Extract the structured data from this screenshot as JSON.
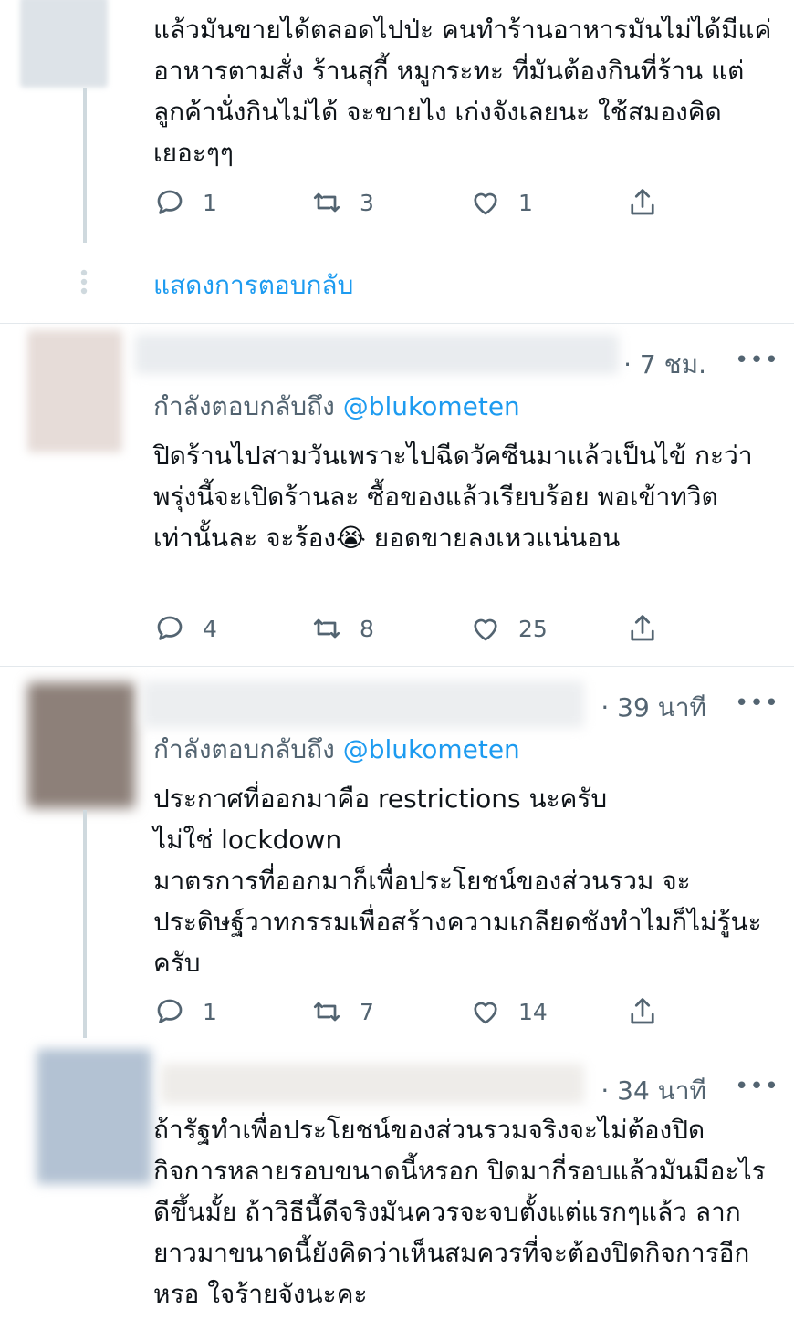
{
  "tweets": [
    {
      "text": "แล้วมันขายได้ตลอดไปป่ะ คนทำร้านอาหารมันไม่ได้มีแค่อาหารตามสั่ง ร้านสุกี้ หมูกระทะ ที่มันต้องกินที่ร้าน แต่ลูกค้านั่งกินไม่ได้ จะขายไง เก่งจังเลยนะ ใช้สมองคิดเยอะๆๆ",
      "replies": "1",
      "retweets": "3",
      "likes": "1"
    },
    {
      "time": "· 7 ชม.",
      "replying_prefix": "กำลังตอบกลับถึง",
      "replying_handle": "@blukometen",
      "text": "ปิดร้านไปสามวันเพราะไปฉีดวัคซีนมาแล้วเป็นไข้ กะว่าพรุ่งนี้จะเปิดร้านละ ซื้อของแล้วเรียบร้อย พอเข้าทวิตเท่านั้นละ จะร้อง😭 ยอดขายลงเหวแน่นอน",
      "replies": "4",
      "retweets": "8",
      "likes": "25"
    },
    {
      "time": "· 39 นาที",
      "replying_prefix": "กำลังตอบกลับถึง",
      "replying_handle": "@blukometen",
      "text": "ประกาศที่ออกมาคือ restrictions นะครับ\nไม่ใช่ lockdown\nมาตรการที่ออกมาก็เพื่อประโยชน์ของส่วนรวม จะประดิษฐ์วาทกรรมเพื่อสร้างความเกลียดชังทำไมก็ไม่รู้นะครับ",
      "replies": "1",
      "retweets": "7",
      "likes": "14"
    },
    {
      "time": "· 34 นาที",
      "text": "ถ้ารัฐทำเพื่อประโยชน์ของส่วนรวมจริงจะไม่ต้องปิดกิจการหลายรอบขนาดนี้หรอก ปิดมากี่รอบแล้วมันมีอะไรดีขึ้นมั้ย ถ้าวิธีนี้ดีจริงมันควรจะจบตั้งแต่แรกๆแล้ว ลากยาวมาขนาดนี้ยังคิดว่าเห็นสมควรที่จะต้องปิดกิจการอีกหรอ ใจร้ายจังนะคะ"
    }
  ],
  "show_replies_label": "แสดงการตอบกลับ",
  "more_label": "•••",
  "icons": [
    "reply-icon",
    "retweet-icon",
    "like-icon",
    "share-icon",
    "more-icon",
    "thread-dots-icon"
  ],
  "colors": {
    "link": "#1d9bf0",
    "muted": "#536471",
    "thread_line": "#cfd9de"
  }
}
